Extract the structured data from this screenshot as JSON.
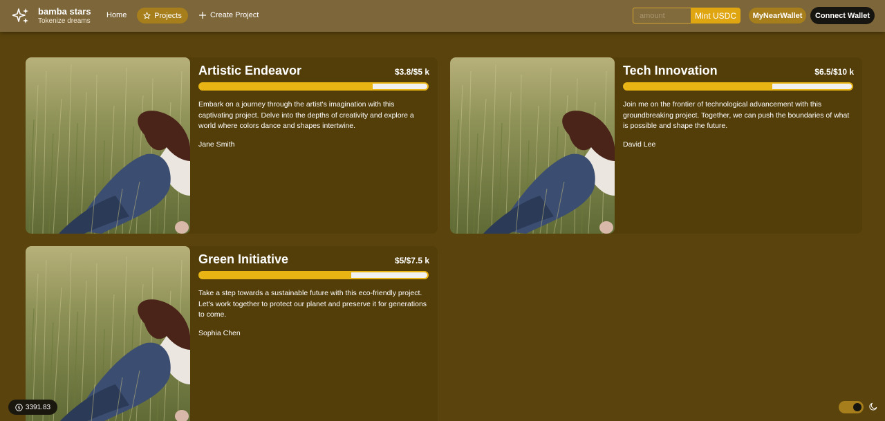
{
  "brand": {
    "name": "bamba stars",
    "tagline": "Tokenize dreams",
    "logo_icon": "sparkles-icon"
  },
  "nav": {
    "home": "Home",
    "projects": "Projects",
    "projects_icon": "star-icon",
    "create": "Create Project",
    "create_icon": "plus-icon"
  },
  "mint": {
    "placeholder": "amount",
    "value": "",
    "button": "Mint USDC"
  },
  "wallet": {
    "name": "MyNearWallet",
    "connect": "Connect Wallet"
  },
  "colors": {
    "accent": "#e8b413",
    "background": "#5a430c",
    "header": "#7d663a",
    "card": "#533e0a"
  },
  "projects": [
    {
      "title": "Artistic Endeavor",
      "amount": "$3.8/$5 k",
      "progress": 0.76,
      "description": "Embark on a journey through the artist's imagination with this captivating project. Delve into the depths of creativity and explore a world where colors dance and shapes intertwine.",
      "author": "Jane Smith"
    },
    {
      "title": "Tech Innovation",
      "amount": "$6.5/$10 k",
      "progress": 0.65,
      "description": "Join me on the frontier of technological advancement with this groundbreaking project. Together, we can push the boundaries of what is possible and shape the future.",
      "author": "David Lee"
    },
    {
      "title": "Green Initiative",
      "amount": "$5/$7.5 k",
      "progress": 0.667,
      "description": "Take a step towards a sustainable future with this eco-friendly project. Let's work together to protect our planet and preserve it for generations to come.",
      "author": "Sophia Chen"
    }
  ],
  "balance": {
    "value": "3391.83",
    "icon": "dollar-coin-icon"
  },
  "theme": {
    "dark_mode": true,
    "icon": "moon-icon"
  }
}
